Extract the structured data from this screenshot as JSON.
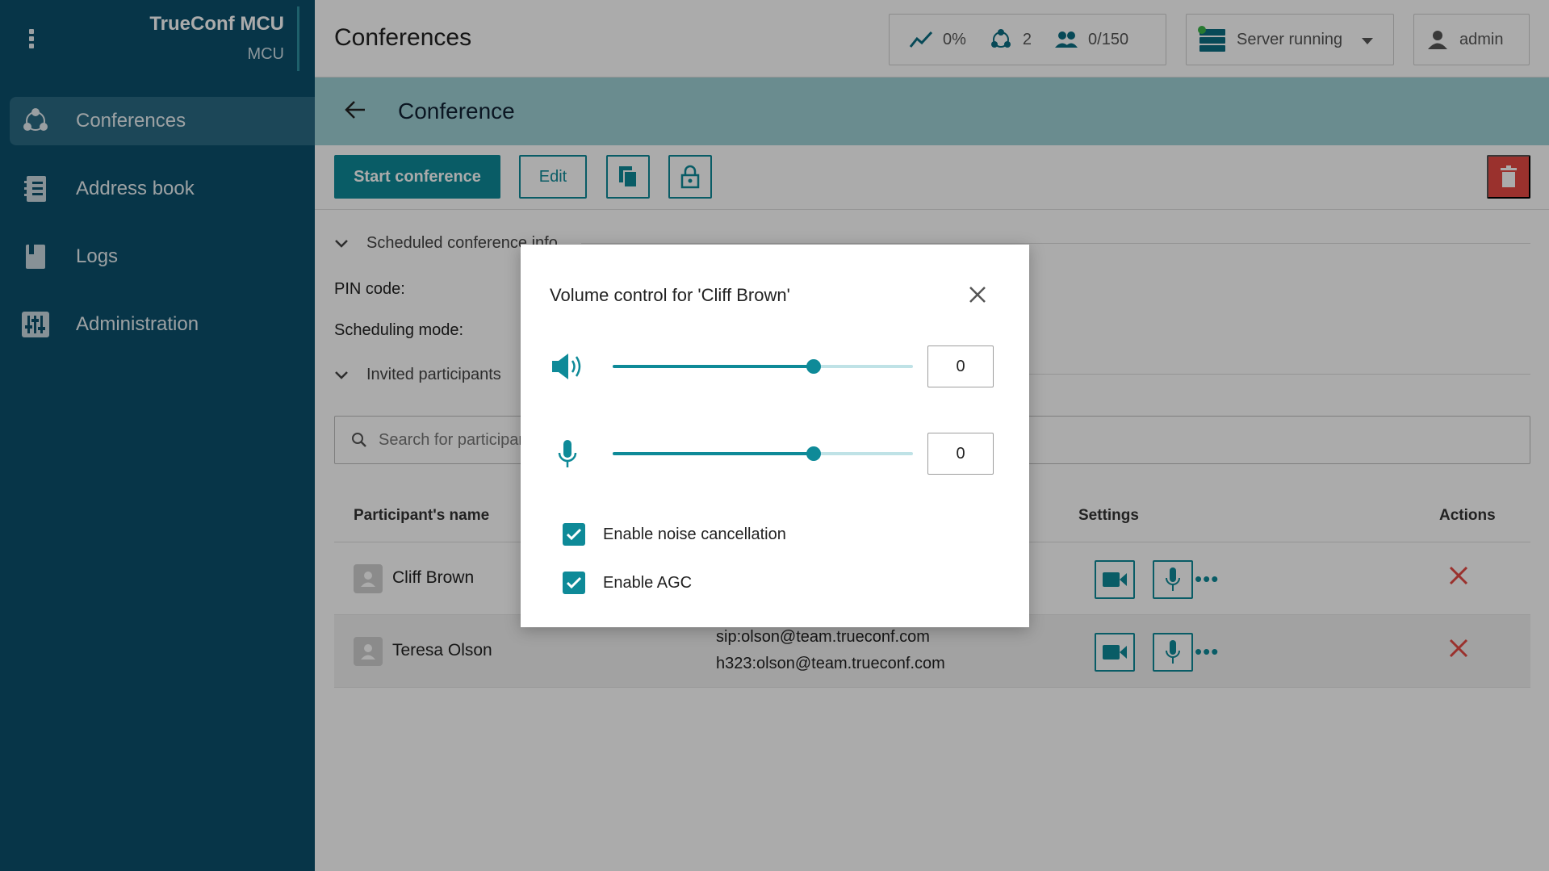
{
  "app": {
    "brand_title": "TrueConf MCU",
    "brand_sub": "MCU"
  },
  "sidebar": {
    "items": [
      {
        "label": "Conferences",
        "icon": "conference-icon",
        "active": true
      },
      {
        "label": "Address book",
        "icon": "address-book-icon"
      },
      {
        "label": "Logs",
        "icon": "logs-icon"
      },
      {
        "label": "Administration",
        "icon": "administration-icon"
      }
    ]
  },
  "topbar": {
    "title": "Conferences",
    "stats": {
      "load": "0%",
      "conferences": "2",
      "participants": "0/150"
    },
    "server_status": "Server running",
    "user": "admin"
  },
  "subheader": {
    "title": "Conference"
  },
  "toolbar": {
    "start_label": "Start conference",
    "edit_label": "Edit"
  },
  "sections": {
    "scheduled_info": "Scheduled conference info",
    "pin_label": "PIN code:",
    "scheduling_label": "Scheduling mode:",
    "invited": "Invited participants"
  },
  "search": {
    "placeholder": "Search for participants"
  },
  "table": {
    "headers": {
      "name": "Participant's name",
      "settings": "Settings",
      "actions": "Actions"
    },
    "rows": [
      {
        "name": "Cliff Brown",
        "addresses": []
      },
      {
        "name": "Teresa Olson",
        "addresses": [
          "sip:olson@team.trueconf.com",
          "h323:olson@team.trueconf.com"
        ]
      }
    ]
  },
  "dialog": {
    "title": "Volume control for 'Cliff Brown'",
    "speaker_value": "0",
    "speaker_level": 0.67,
    "mic_value": "0",
    "mic_level": 0.67,
    "noise_label": "Enable noise cancellation",
    "noise_checked": true,
    "agc_label": "Enable AGC",
    "agc_checked": true
  },
  "colors": {
    "sidebar": "#0b4f6c",
    "accent": "#0e8a98",
    "subheader": "#9fd1d6",
    "danger": "#e64a44"
  }
}
